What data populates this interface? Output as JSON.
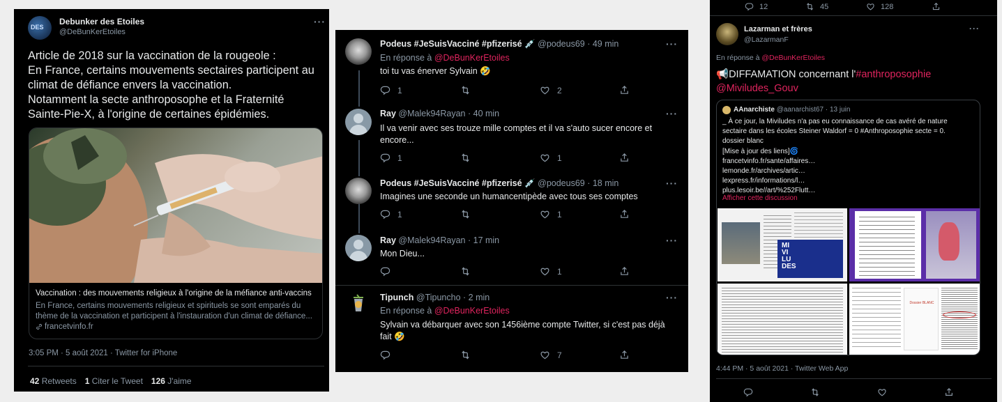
{
  "tweet1": {
    "author": "Debunker des Etoiles",
    "handle": "@DeBunKerEtoiles",
    "avatar_text": "DES",
    "lines": [
      "Article de 2018 sur la vaccination de la rougeole :",
      "En France, certains mouvements sectaires participent au",
      "climat de défiance envers la vaccination.",
      "Notamment la secte anthroposophe et la Fraternité",
      "Sainte-Pie-X, à l'origine de certaines épidémies."
    ],
    "card_title": "Vaccination : des mouvements religieux à l'origine de la méfiance anti-vaccins",
    "card_desc_1": "En France, certains mouvements religieux et spirituels se sont emparés du",
    "card_desc_2": "thème de la vaccination et participent à l'instauration d'un climat de défiance...",
    "card_domain": "francetvinfo.fr",
    "timestamp": "3:05 PM · 5 août 2021 · Twitter for iPhone",
    "retweets_count": "42",
    "retweets_label": "Retweets",
    "quotes_count": "1",
    "quotes_label": "Citer le Tweet",
    "likes_count": "126",
    "likes_label": "J'aime"
  },
  "replies": [
    {
      "author": "Podeus #JeSuisVacciné #pfizerisé",
      "emoji": "💉",
      "handle": "@podeus69",
      "time": "· 49 min",
      "reply_to_prefix": "En réponse à",
      "reply_to": "@DeBunKerEtoiles",
      "text": "toi tu vas énerver Sylvain 🤣",
      "replies": "1",
      "likes": "2"
    },
    {
      "author": "Ray",
      "emoji": "",
      "handle": "@Malek94Rayan",
      "time": "· 40 min",
      "text1": "Il va venir avec ses trouze mille  comptes et il va s'auto sucer encore et",
      "text2": "encore...",
      "replies": "1",
      "likes": "1"
    },
    {
      "author": "Podeus #JeSuisVacciné #pfizerisé",
      "emoji": "💉",
      "handle": "@podeus69",
      "time": "· 18 min",
      "text": "Imagines une seconde un humancentipède avec tous ses comptes",
      "replies": "1",
      "likes": "1"
    },
    {
      "author": "Ray",
      "emoji": "",
      "handle": "@Malek94Rayan",
      "time": "· 17 min",
      "text": "Mon Dieu...",
      "replies": "",
      "likes": "1"
    },
    {
      "author": "Tipunch",
      "emoji": "",
      "handle": "@Tipuncho",
      "time": "· 2 min",
      "reply_to_prefix": "En réponse à",
      "reply_to": "@DeBunKerEtoiles",
      "text1": "Sylvain va débarquer avec son 1456ième compte Twitter, si c'est pas déjà",
      "text2": "fait 🤣",
      "replies": "",
      "likes": "7"
    }
  ],
  "tweet3": {
    "top_replies": "12",
    "top_retweets": "45",
    "top_likes": "128",
    "author": "Lazarman et frères",
    "handle": "@LazarmanF",
    "reply_to_prefix": "En réponse à",
    "reply_to": "@DeBunKerEtoiles",
    "text_emoji": "📢",
    "text_plain": "DIFFAMATION concernant l'",
    "text_hashtag": "#anthroposophie",
    "text_mention": "@Miviludes_Gouv",
    "quote": {
      "author": "AAnarchiste",
      "handle": "@aanarchist67",
      "date": "· 13 juin",
      "lines": [
        "_ À ce jour, la Miviludes n'a pas eu connaissance de cas avéré de nature",
        "sectaire dans les écoles Steiner Waldorf = 0 #Anthroposophie secte = 0.",
        "dossier blanc",
        "[Mise à jour des liens]🌀",
        "francetvinfo.fr/sante/affaires…",
        "lemonde.fr/archives/artic…",
        "lexpress.fr/informations/l…",
        "plus.lesoir.be//art/%252Flutt…"
      ],
      "show_thread": "Afficher cette discussion",
      "miviludes_line1": "MI",
      "miviludes_line2": "VI",
      "miviludes_line3": "LU",
      "miviludes_line4": "DES",
      "dossier_label": "Dossier BLANC"
    },
    "timestamp": "4:44 PM · 5 août 2021 · Twitter Web App"
  },
  "colors": {
    "background": "#000000",
    "page": "#eeeeee",
    "accent": "#e0245e",
    "muted": "#8b98a5",
    "text": "#d9d9d9"
  },
  "icons": [
    "reply-icon",
    "retweet-icon",
    "like-icon",
    "share-icon",
    "more-icon",
    "link-icon"
  ]
}
